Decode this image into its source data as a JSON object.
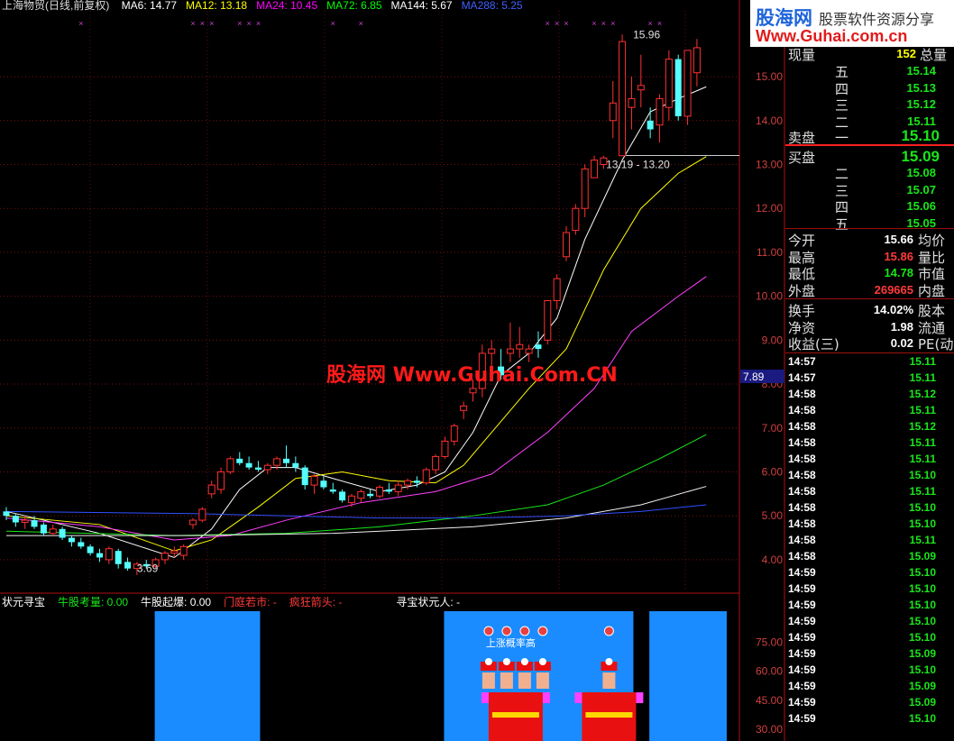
{
  "header": {
    "title": "上海物贸(日线,前复权)",
    "ma_labels": [
      {
        "text": "MA6: 14.77",
        "color": "#ffffff"
      },
      {
        "text": "MA12: 13.18",
        "color": "#ffff00"
      },
      {
        "text": "MA24: 10.45",
        "color": "#ff00ff"
      },
      {
        "text": "MA72: 6.85",
        "color": "#00ff00"
      },
      {
        "text": "MA144: 5.67",
        "color": "#ffffff"
      },
      {
        "text": "MA288: 5.25",
        "color": "#4060ff"
      }
    ]
  },
  "logo": {
    "cn": "股海网",
    "sub": "股票软件资源分享",
    "url": "Www.Guhai.com.cn"
  },
  "watermark": "股海网 Www.Guhai.Com.CN",
  "chart_data": {
    "type": "candlestick",
    "ylim": [
      3.3,
      16.5
    ],
    "y_ticks": [
      "4.00",
      "5.00",
      "6.00",
      "7.00",
      "8.00",
      "9.00",
      "10.00",
      "11.00",
      "12.00",
      "13.00",
      "14.00",
      "15.00"
    ],
    "y_tick_values": [
      4,
      5,
      6,
      7,
      8,
      9,
      10,
      11,
      12,
      13,
      14,
      15
    ],
    "candles": [
      [
        5.1,
        5.2,
        4.9,
        5.0
      ],
      [
        5.0,
        5.05,
        4.75,
        4.85
      ],
      [
        4.85,
        5.0,
        4.7,
        4.9
      ],
      [
        4.9,
        5.0,
        4.7,
        4.75
      ],
      [
        4.8,
        4.85,
        4.55,
        4.6
      ],
      [
        4.6,
        4.8,
        4.55,
        4.7
      ],
      [
        4.7,
        4.75,
        4.45,
        4.5
      ],
      [
        4.5,
        4.55,
        4.3,
        4.4
      ],
      [
        4.4,
        4.5,
        4.25,
        4.3
      ],
      [
        4.3,
        4.35,
        4.1,
        4.15
      ],
      [
        4.15,
        4.25,
        3.95,
        4.05
      ],
      [
        4.0,
        4.3,
        3.9,
        4.25
      ],
      [
        4.2,
        4.25,
        3.8,
        3.9
      ],
      [
        3.95,
        4.05,
        3.75,
        3.8
      ],
      [
        3.8,
        3.95,
        3.65,
        3.9
      ],
      [
        3.9,
        4.0,
        3.8,
        3.85
      ],
      [
        3.85,
        4.05,
        3.8,
        4.0
      ],
      [
        4.0,
        4.2,
        3.9,
        4.15
      ],
      [
        4.15,
        4.3,
        4.05,
        4.2
      ],
      [
        4.1,
        4.35,
        4.0,
        4.3
      ],
      [
        4.8,
        4.95,
        4.7,
        4.9
      ],
      [
        4.9,
        5.2,
        4.85,
        5.15
      ],
      [
        5.5,
        5.8,
        5.4,
        5.7
      ],
      [
        5.6,
        6.1,
        5.5,
        6.0
      ],
      [
        6.0,
        6.35,
        5.95,
        6.3
      ],
      [
        6.3,
        6.45,
        6.15,
        6.2
      ],
      [
        6.2,
        6.35,
        6.05,
        6.1
      ],
      [
        6.1,
        6.25,
        6.0,
        6.05
      ],
      [
        6.05,
        6.2,
        5.95,
        6.15
      ],
      [
        6.15,
        6.35,
        6.05,
        6.3
      ],
      [
        6.3,
        6.6,
        6.1,
        6.2
      ],
      [
        6.2,
        6.35,
        6.0,
        6.1
      ],
      [
        6.1,
        6.15,
        5.6,
        5.7
      ],
      [
        5.7,
        5.95,
        5.5,
        5.9
      ],
      [
        5.8,
        5.9,
        5.6,
        5.65
      ],
      [
        5.6,
        5.75,
        5.5,
        5.55
      ],
      [
        5.55,
        5.6,
        5.3,
        5.35
      ],
      [
        5.3,
        5.5,
        5.2,
        5.45
      ],
      [
        5.4,
        5.6,
        5.3,
        5.55
      ],
      [
        5.5,
        5.6,
        5.4,
        5.45
      ],
      [
        5.45,
        5.7,
        5.4,
        5.65
      ],
      [
        5.6,
        5.75,
        5.5,
        5.55
      ],
      [
        5.55,
        5.8,
        5.45,
        5.7
      ],
      [
        5.7,
        5.85,
        5.6,
        5.8
      ],
      [
        5.8,
        5.9,
        5.65,
        5.75
      ],
      [
        5.75,
        6.1,
        5.7,
        6.05
      ],
      [
        6.05,
        6.4,
        5.95,
        6.35
      ],
      [
        6.35,
        6.8,
        6.3,
        6.7
      ],
      [
        6.7,
        7.1,
        6.6,
        7.05
      ],
      [
        7.4,
        7.6,
        7.2,
        7.5
      ],
      [
        7.8,
        8.1,
        7.6,
        7.9
      ],
      [
        7.9,
        8.9,
        7.7,
        8.7
      ],
      [
        8.7,
        9.0,
        8.2,
        8.8
      ],
      [
        8.4,
        8.8,
        8.1,
        8.2
      ],
      [
        8.7,
        9.4,
        8.5,
        8.8
      ],
      [
        8.8,
        9.3,
        8.6,
        8.9
      ],
      [
        8.7,
        8.9,
        8.5,
        8.8
      ],
      [
        8.9,
        9.2,
        8.6,
        8.8
      ],
      [
        9.0,
        9.9,
        8.9,
        9.9
      ],
      [
        9.9,
        10.5,
        9.7,
        10.4
      ],
      [
        10.9,
        11.6,
        10.8,
        11.45
      ],
      [
        11.5,
        12.1,
        11.4,
        12.0
      ],
      [
        12.0,
        13.0,
        11.8,
        12.9
      ],
      [
        12.7,
        13.2,
        12.7,
        13.1
      ],
      [
        13.0,
        13.2,
        12.9,
        13.15
      ],
      [
        14.0,
        14.9,
        13.6,
        14.4
      ],
      [
        13.2,
        15.96,
        13.2,
        15.8
      ],
      [
        14.3,
        15.0,
        13.8,
        14.5
      ],
      [
        14.7,
        15.5,
        14.3,
        14.8
      ],
      [
        14.0,
        14.3,
        13.6,
        13.8
      ],
      [
        13.9,
        14.6,
        13.5,
        14.5
      ],
      [
        14.3,
        15.6,
        14.0,
        15.4
      ],
      [
        15.4,
        15.5,
        14.0,
        14.1
      ],
      [
        14.1,
        15.6,
        13.9,
        15.6
      ],
      [
        15.09,
        15.86,
        14.78,
        15.66
      ]
    ],
    "candle_up_color": "#ff3030",
    "candle_down_color": "#54ffff",
    "ma_series": [
      {
        "name": "MA6",
        "color": "#ffffff",
        "points": [
          [
            0,
            5.1
          ],
          [
            10,
            4.6
          ],
          [
            18,
            4.05
          ],
          [
            22,
            4.7
          ],
          [
            25,
            5.6
          ],
          [
            28,
            6.1
          ],
          [
            31,
            6.1
          ],
          [
            35,
            5.85
          ],
          [
            40,
            5.55
          ],
          [
            44,
            5.7
          ],
          [
            47,
            6.0
          ],
          [
            50,
            6.9
          ],
          [
            53,
            8.2
          ],
          [
            56,
            8.7
          ],
          [
            59,
            9.5
          ],
          [
            62,
            11.3
          ],
          [
            66,
            13.1
          ],
          [
            69,
            14.2
          ],
          [
            72,
            14.5
          ],
          [
            75,
            14.77
          ]
        ]
      },
      {
        "name": "MA12",
        "color": "#ffff00",
        "points": [
          [
            0,
            5.0
          ],
          [
            10,
            4.8
          ],
          [
            18,
            4.2
          ],
          [
            22,
            4.45
          ],
          [
            27,
            5.2
          ],
          [
            31,
            5.85
          ],
          [
            36,
            6.0
          ],
          [
            41,
            5.8
          ],
          [
            46,
            5.75
          ],
          [
            49,
            6.15
          ],
          [
            52,
            6.9
          ],
          [
            56,
            7.9
          ],
          [
            60,
            8.8
          ],
          [
            64,
            10.6
          ],
          [
            68,
            12.0
          ],
          [
            72,
            12.8
          ],
          [
            75,
            13.18
          ]
        ]
      },
      {
        "name": "MA24",
        "color": "#ff40ff",
        "points": [
          [
            0,
            4.95
          ],
          [
            10,
            4.75
          ],
          [
            18,
            4.45
          ],
          [
            24,
            4.55
          ],
          [
            30,
            4.9
          ],
          [
            38,
            5.3
          ],
          [
            46,
            5.55
          ],
          [
            52,
            5.95
          ],
          [
            58,
            6.9
          ],
          [
            63,
            7.9
          ],
          [
            67,
            9.2
          ],
          [
            72,
            10.0
          ],
          [
            75,
            10.45
          ]
        ]
      },
      {
        "name": "MA72",
        "color": "#19e619",
        "points": [
          [
            0,
            4.65
          ],
          [
            18,
            4.55
          ],
          [
            30,
            4.6
          ],
          [
            40,
            4.75
          ],
          [
            50,
            5.0
          ],
          [
            58,
            5.25
          ],
          [
            64,
            5.7
          ],
          [
            70,
            6.3
          ],
          [
            75,
            6.85
          ]
        ]
      },
      {
        "name": "MA144",
        "color": "#f0f0f0",
        "points": [
          [
            0,
            4.55
          ],
          [
            20,
            4.55
          ],
          [
            35,
            4.6
          ],
          [
            50,
            4.75
          ],
          [
            60,
            4.95
          ],
          [
            68,
            5.25
          ],
          [
            75,
            5.67
          ]
        ]
      },
      {
        "name": "MA288",
        "color": "#3050ff",
        "points": [
          [
            0,
            5.1
          ],
          [
            20,
            5.05
          ],
          [
            30,
            5.0
          ],
          [
            40,
            4.95
          ],
          [
            50,
            4.95
          ],
          [
            60,
            5.0
          ],
          [
            68,
            5.1
          ],
          [
            75,
            5.25
          ]
        ]
      }
    ],
    "annotations": [
      {
        "text": "15.96",
        "x": 66,
        "y": 15.96
      },
      {
        "text": "13.19 - 13.20",
        "x": 66,
        "y": 13.0
      },
      {
        "text": "3.69",
        "x": 14,
        "y": 3.8
      }
    ],
    "current_price_marker": "7.89",
    "subchart": {
      "labels": [
        {
          "text": "状元寻宝",
          "color": "#ffffff"
        },
        {
          "text": "牛股考量: 0.00",
          "color": "#19e619"
        },
        {
          "text": "牛股起爆: 0.00",
          "color": "#ffffff"
        },
        {
          "text": "门庭若市: -",
          "color": "#ff3a3a"
        },
        {
          "text": "疯狂箭头: -",
          "color": "#ff3a3a"
        },
        {
          "text": "寻宝状元人: -",
          "color": "#ffffff"
        }
      ],
      "y_ticks": [
        "75.00",
        "60.00",
        "45.00",
        "30.00"
      ],
      "y_tick_values": [
        75,
        60,
        45,
        30
      ],
      "ylim": [
        24,
        92
      ],
      "blue_blocks": [
        [
          16,
          27
        ],
        [
          47,
          67
        ],
        [
          69,
          77
        ]
      ],
      "figure_text": "上涨概率高"
    }
  },
  "quote_panel": {
    "top_row": {
      "left": "现量",
      "value": "152",
      "right": "总量"
    },
    "sell": [
      {
        "label": "五",
        "price": "15.14"
      },
      {
        "label": "四",
        "price": "15.13"
      },
      {
        "label": "三",
        "price": "15.12"
      },
      {
        "label": "二",
        "price": "15.11"
      }
    ],
    "sell_main": {
      "label": "卖盘",
      "level": "一",
      "price": "15.10"
    },
    "buy_main": {
      "label": "买盘",
      "price": "15.09"
    },
    "buy": [
      {
        "label": "二",
        "price": "15.08"
      },
      {
        "label": "三",
        "price": "15.07"
      },
      {
        "label": "四",
        "price": "15.06"
      },
      {
        "label": "五",
        "price": "15.05"
      }
    ],
    "stats1": [
      {
        "l": "今开",
        "v": "15.66",
        "c": "#ffffff",
        "r": "均价"
      },
      {
        "l": "最高",
        "v": "15.86",
        "c": "#ff3a3a",
        "r": "量比"
      },
      {
        "l": "最低",
        "v": "14.78",
        "c": "#19e619",
        "r": "市值"
      },
      {
        "l": "外盘",
        "v": "269665",
        "c": "#ff3a3a",
        "r": "内盘"
      }
    ],
    "stats2": [
      {
        "l": "换手",
        "v": "14.02%",
        "c": "#ffffff",
        "r": "股本"
      },
      {
        "l": "净资",
        "v": "1.98",
        "c": "#ffffff",
        "r": "流通"
      },
      {
        "l": "收益(三)",
        "v": "0.02",
        "c": "#ffffff",
        "r": "PE(动"
      }
    ],
    "ticks": [
      {
        "t": "14:57",
        "p": "15.11",
        "c": "#19e619"
      },
      {
        "t": "14:57",
        "p": "15.11",
        "c": "#19e619"
      },
      {
        "t": "14:58",
        "p": "15.12",
        "c": "#19e619"
      },
      {
        "t": "14:58",
        "p": "15.11",
        "c": "#19e619"
      },
      {
        "t": "14:58",
        "p": "15.12",
        "c": "#19e619"
      },
      {
        "t": "14:58",
        "p": "15.11",
        "c": "#19e619"
      },
      {
        "t": "14:58",
        "p": "15.11",
        "c": "#19e619"
      },
      {
        "t": "14:58",
        "p": "15.10",
        "c": "#19e619"
      },
      {
        "t": "14:58",
        "p": "15.11",
        "c": "#19e619"
      },
      {
        "t": "14:58",
        "p": "15.10",
        "c": "#19e619"
      },
      {
        "t": "14:58",
        "p": "15.10",
        "c": "#19e619"
      },
      {
        "t": "14:58",
        "p": "15.11",
        "c": "#19e619"
      },
      {
        "t": "14:58",
        "p": "15.09",
        "c": "#19e619"
      },
      {
        "t": "14:59",
        "p": "15.10",
        "c": "#19e619"
      },
      {
        "t": "14:59",
        "p": "15.10",
        "c": "#19e619"
      },
      {
        "t": "14:59",
        "p": "15.10",
        "c": "#19e619"
      },
      {
        "t": "14:59",
        "p": "15.10",
        "c": "#19e619"
      },
      {
        "t": "14:59",
        "p": "15.10",
        "c": "#19e619"
      },
      {
        "t": "14:59",
        "p": "15.09",
        "c": "#19e619"
      },
      {
        "t": "14:59",
        "p": "15.10",
        "c": "#19e619"
      },
      {
        "t": "14:59",
        "p": "15.09",
        "c": "#19e619"
      },
      {
        "t": "14:59",
        "p": "15.09",
        "c": "#19e619"
      },
      {
        "t": "14:59",
        "p": "15.10",
        "c": "#19e619"
      }
    ]
  }
}
